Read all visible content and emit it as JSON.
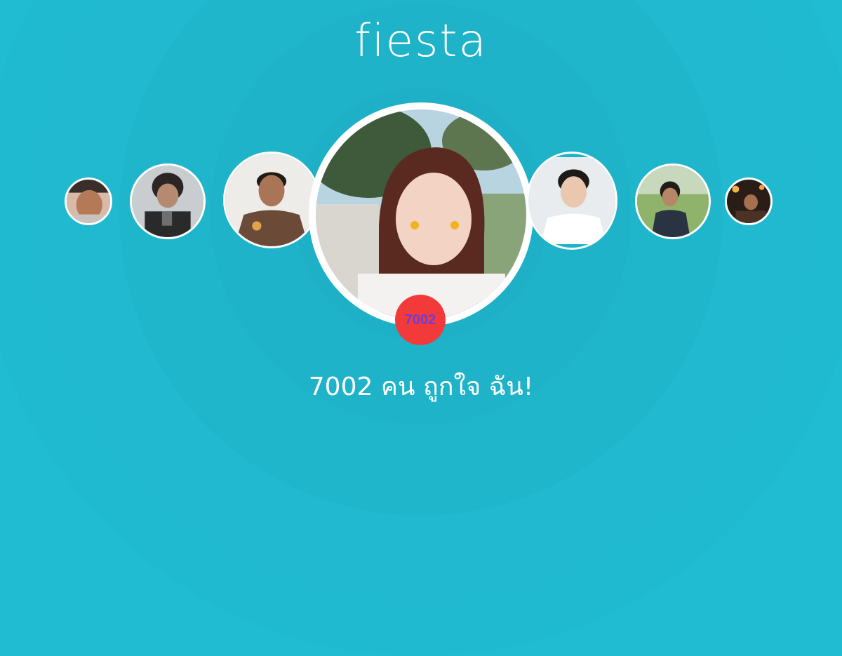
{
  "app": {
    "logo_text": "fiesta"
  },
  "main_profile": {
    "like_count": "7002"
  },
  "caption": {
    "text": "7002 คน ถูกใจ ฉัน!"
  },
  "colors": {
    "background": "#1fbcd2",
    "badge": "#f23a3a",
    "badge_text": "#6b3fd6",
    "text": "#ffffff"
  },
  "avatars": [
    {
      "name": "avatar-far-left"
    },
    {
      "name": "avatar-left-2"
    },
    {
      "name": "avatar-left-1"
    },
    {
      "name": "avatar-main"
    },
    {
      "name": "avatar-right-1"
    },
    {
      "name": "avatar-right-2"
    },
    {
      "name": "avatar-far-right"
    }
  ]
}
